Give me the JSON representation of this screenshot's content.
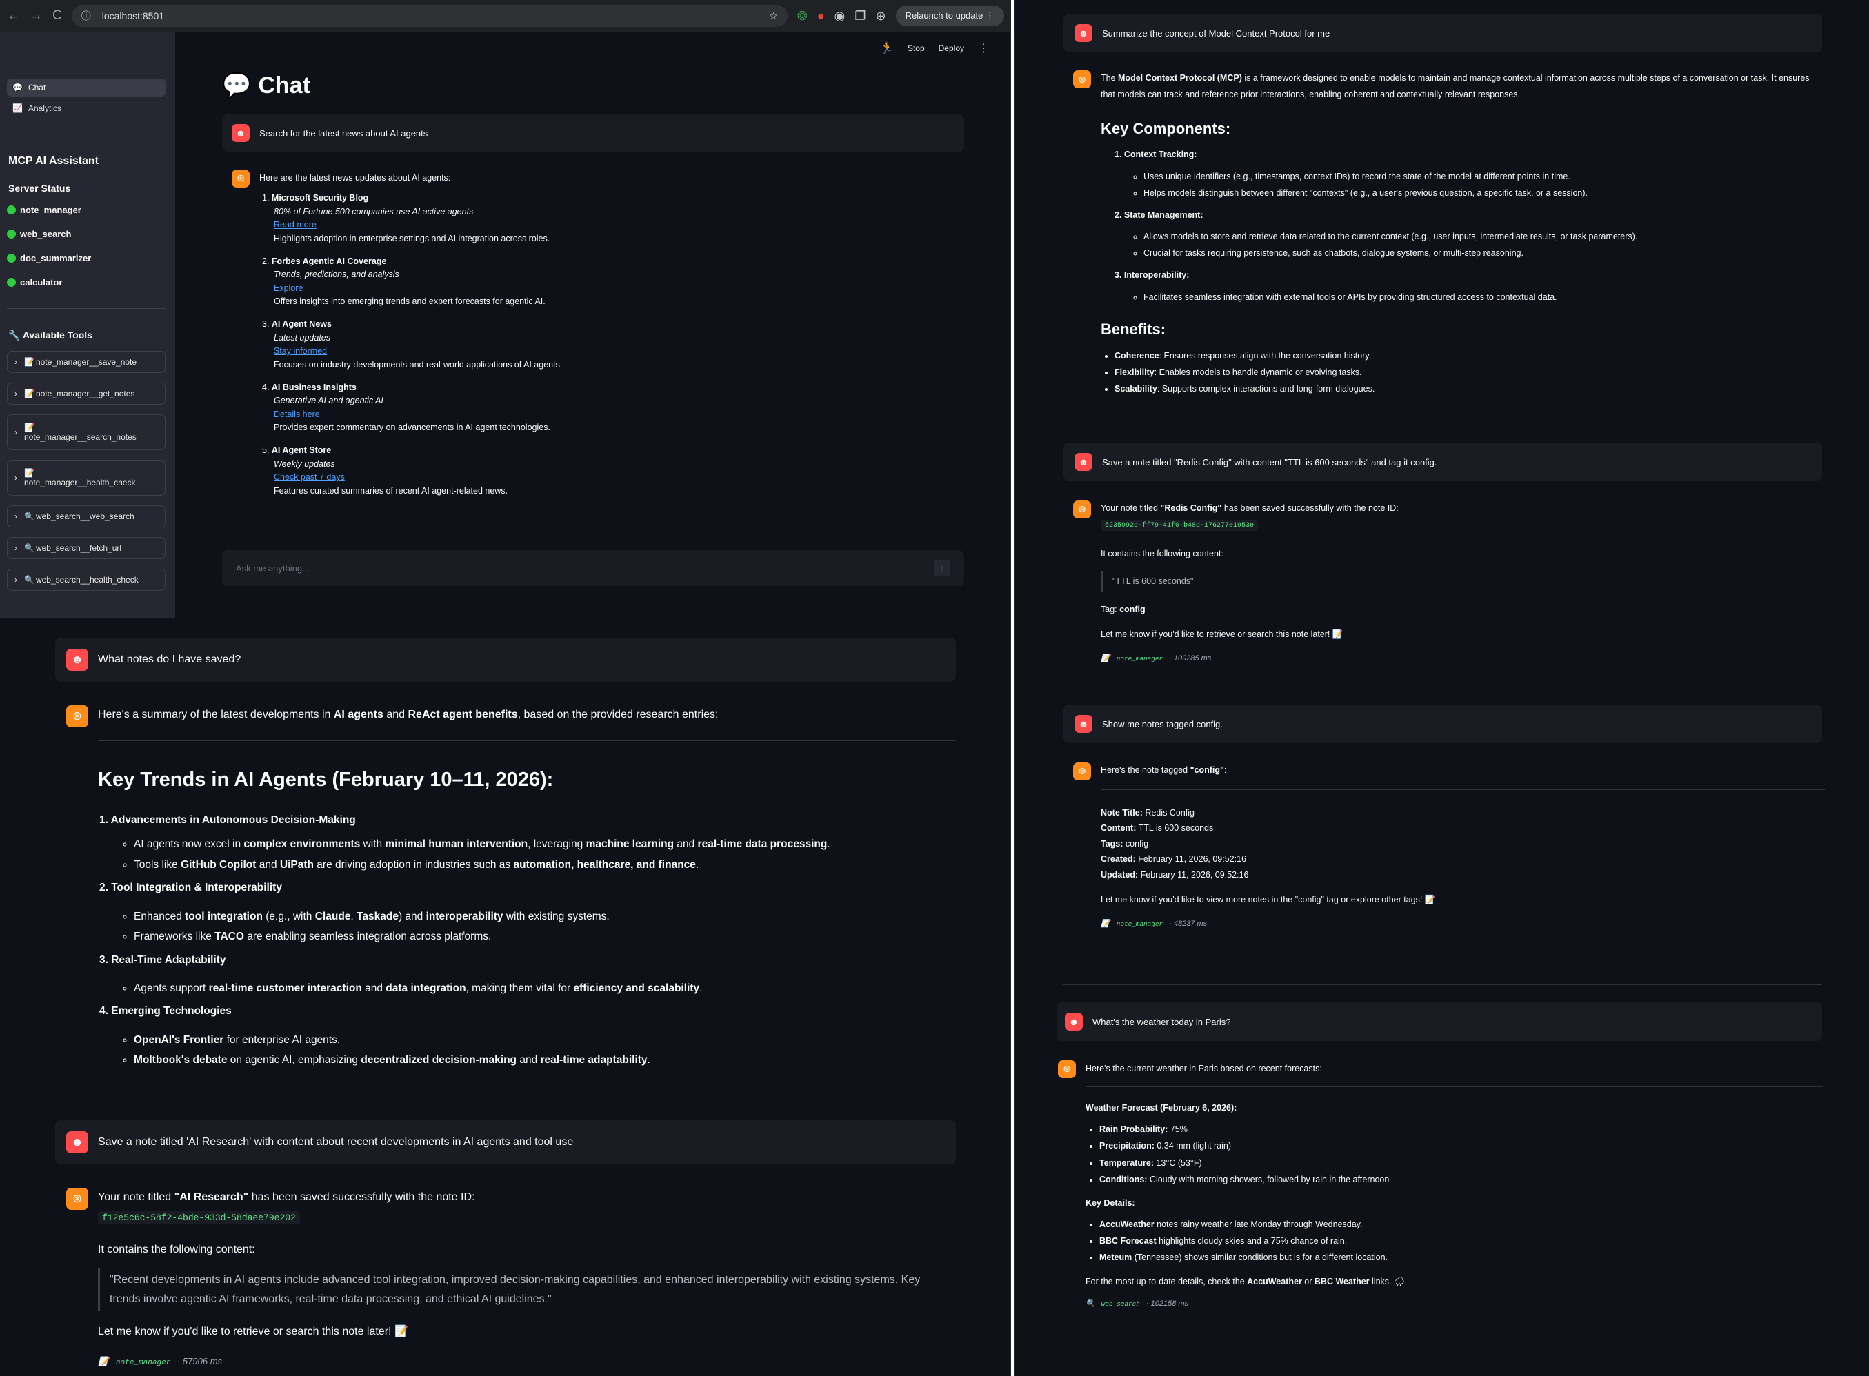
{
  "browser": {
    "url": "localhost:8501",
    "relaunch": "Relaunch to update",
    "back": "←",
    "fwd": "→",
    "reload": "C",
    "info": "ⓘ",
    "star": "☆",
    "ext_icons": [
      "❂",
      "●",
      "◉",
      "❐",
      "⊕"
    ],
    "menu": "⋮"
  },
  "app": {
    "stop": "Stop",
    "deploy": "Deploy",
    "menu": "⋮",
    "title": "Chat",
    "title_icon": "💬",
    "input_placeholder": "Ask me anything...",
    "send": "↑"
  },
  "sidebar": {
    "nav": [
      {
        "label": "Chat",
        "icon": "💬"
      },
      {
        "label": "Analytics",
        "icon": "📈"
      }
    ],
    "app_title": "MCP AI Assistant",
    "server_status_title": "Server Status",
    "servers": [
      "note_manager",
      "web_search",
      "doc_summarizer",
      "calculator"
    ],
    "tools_title": "Available Tools",
    "tools_icon": "🔧",
    "tools": [
      {
        "icon": "📝",
        "label": "note_manager__save_note"
      },
      {
        "icon": "📝",
        "label": "note_manager__get_notes"
      },
      {
        "icon": "📝",
        "label": "note_manager__search_notes"
      },
      {
        "icon": "📝",
        "label": "note_manager__health_check"
      },
      {
        "icon": "🔍",
        "label": "web_search__web_search"
      },
      {
        "icon": "🔍",
        "label": "web_search__fetch_url"
      },
      {
        "icon": "🔍",
        "label": "web_search__health_check"
      }
    ]
  },
  "icons": {
    "user": "☻",
    "assistant": "⊛",
    "chevron": "›",
    "meta_note": "📝",
    "meta_web": "🔍",
    "memo": "📝",
    "cloud": "🌧"
  },
  "panel_a": {
    "user_msg": "Search for the latest news about AI agents",
    "intro": "Here are the latest news updates about AI agents:",
    "news": [
      {
        "title": "Microsoft Security Blog",
        "sub": "80% of Fortune 500 companies use AI active agents",
        "link": "Read more",
        "desc": "Highlights adoption in enterprise settings and AI integration across roles."
      },
      {
        "title": "Forbes Agentic AI Coverage",
        "sub": "Trends, predictions, and analysis",
        "link": "Explore",
        "desc": "Offers insights into emerging trends and expert forecasts for agentic AI."
      },
      {
        "title": "AI Agent News",
        "sub": "Latest updates",
        "link": "Stay informed",
        "desc": "Focuses on industry developments and real-world applications of AI agents."
      },
      {
        "title": "AI Business Insights",
        "sub": "Generative AI and agentic AI",
        "link": "Details here",
        "desc": "Provides expert commentary on advancements in AI agent technologies."
      },
      {
        "title": "AI Agent Store",
        "sub": "Weekly updates",
        "link": "Check past 7 days",
        "desc": "Features curated summaries of recent AI agent-related news."
      }
    ]
  },
  "panel_b": {
    "user1": "What notes do I have saved?",
    "intro": {
      "p1": "Here's a summary of the latest developments in ",
      "b1": "AI agents",
      "p2": " and ",
      "b2": "ReAct agent benefits",
      "p3": ", based on the provided research entries:"
    },
    "heading": "Key Trends in AI Agents (February 10–11, 2026):",
    "user2": "Save a note titled 'AI Research' with content about recent developments in AI agents and tool use",
    "saved": {
      "p1": "Your note titled ",
      "b1": "\"AI Research\"",
      "p2": " has been saved successfully with the note ID:",
      "id": "f12e5c6c-58f2-4bde-933d-58daee79e202",
      "contains": "It contains the following content:",
      "quote": "\"Recent developments in AI agents include advanced tool integration, improved decision-making capabilities, and enhanced interoperability with existing systems. Key trends involve agentic AI frameworks, real-time data processing, and ethical AI guidelines.\"",
      "followup": "Let me know if you'd like to retrieve or search this note later!",
      "meta_tool": "note_manager",
      "meta_time": " · 57906 ms"
    }
  },
  "panel_c": {
    "user1": "Summarize the concept of Model Context Protocol for me",
    "mcp_intro": {
      "p1": "The ",
      "b1": "Model Context Protocol (MCP)",
      "p2": " is a framework designed to enable models to maintain and manage contextual information across multiple steps of a conversation or task. It ensures that models can track and reference prior interactions, enabling coherent and contextually relevant responses."
    },
    "kc_title": "Key Components:",
    "benefits_title": "Benefits:",
    "user2": "Save a note titled \"Redis Config\" with content \"TTL is 600 seconds\" and tag it config.",
    "redis": {
      "p1": "Your note titled ",
      "b1": "\"Redis Config\"",
      "p2": " has been saved successfully with the note ID:",
      "id": "5235992d-ff79-41f0-b48d-176277e1953e",
      "contains": "It contains the following content:",
      "quote": "\"TTL is 600 seconds\"",
      "tag_label": "Tag: ",
      "tag": "config",
      "followup": "Let me know if you'd like to retrieve or search this note later!",
      "meta_tool": "note_manager",
      "meta_time": " · 109285 ms"
    },
    "user3": "Show me notes tagged config.",
    "tagged": {
      "p1": "Here's the note tagged ",
      "b1": "\"config\"",
      "p2": ":",
      "title_l": "Note Title:",
      "title_v": " Redis Config",
      "content_l": "Content:",
      "content_v": " TTL is 600 seconds",
      "tags_l": "Tags:",
      "tags_v": " config",
      "created_l": "Created:",
      "created_v": " February 11, 2026, 09:52:16",
      "updated_l": "Updated:",
      "updated_v": " February 11, 2026, 09:52:16",
      "followup": "Let me know if you'd like to view more notes in the \"config\" tag or explore other tags!",
      "meta_tool": "note_manager",
      "meta_time": " · 48237 ms"
    },
    "user4": "What's the weather today in Paris?",
    "weather": {
      "intro": "Here's the current weather in Paris based on recent forecasts:",
      "fc_title": "Weather Forecast (February 6, 2026):",
      "kd_title": "Key Details:",
      "final": {
        "p1": "For the most up-to-date details, check the ",
        "b1": "AccuWeather",
        "p2": " or ",
        "b2": "BBC Weather",
        "p3": " links."
      },
      "meta_tool": "web_search",
      "meta_time": " · 102158 ms"
    }
  }
}
